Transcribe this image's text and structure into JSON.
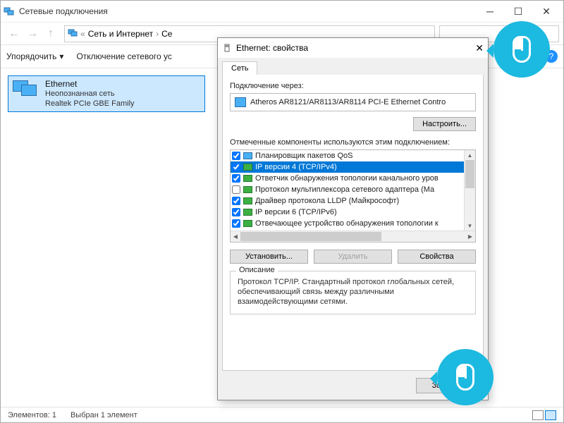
{
  "explorer": {
    "title": "Сетевые подключения",
    "breadcrumb": {
      "sep": "«",
      "part1": "Сеть и Интернет",
      "part2": "Се"
    },
    "toolbar": {
      "organize": "Упорядочить",
      "disable": "Отключение сетевого ус"
    },
    "connection": {
      "name": "Ethernet",
      "status": "Неопознанная сеть",
      "adapter": "Realtek PCIe GBE Family"
    },
    "statusbar": {
      "count": "Элементов: 1",
      "selected": "Выбран 1 элемент"
    }
  },
  "dialog": {
    "title": "Ethernet: свойства",
    "tab": "Сеть",
    "connect_via": "Подключение через:",
    "adapter": "Atheros AR8121/AR8113/AR8114 PCI-E Ethernet Contro",
    "configure": "Настроить...",
    "components_label": "Отмеченные компоненты используются этим подключением:",
    "components": [
      {
        "checked": true,
        "sel": false,
        "qos": true,
        "label": "Планировщик пакетов QoS"
      },
      {
        "checked": true,
        "sel": true,
        "qos": false,
        "label": "IP версии 4 (TCP/IPv4)"
      },
      {
        "checked": true,
        "sel": false,
        "qos": false,
        "label": "Ответчик обнаружения топологии канального уров"
      },
      {
        "checked": false,
        "sel": false,
        "qos": false,
        "label": "Протокол мультиплексора сетевого адаптера (Ма"
      },
      {
        "checked": true,
        "sel": false,
        "qos": false,
        "label": "Драйвер протокола LLDP (Майкрософт)"
      },
      {
        "checked": true,
        "sel": false,
        "qos": false,
        "label": "IP версии 6 (TCP/IPv6)"
      },
      {
        "checked": true,
        "sel": false,
        "qos": false,
        "label": "Отвечающее устройство обнаружения топологии к"
      }
    ],
    "install": "Установить...",
    "uninstall": "Удалить",
    "properties": "Свойства",
    "desc_title": "Описание",
    "desc": "Протокол TCP/IP. Стандартный протокол глобальных сетей, обеспечивающий связь между различными взаимодействующими сетями.",
    "close": "Закрыть"
  }
}
